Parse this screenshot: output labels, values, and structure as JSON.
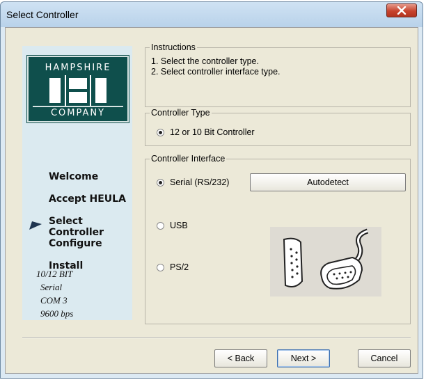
{
  "window": {
    "title": "Select Controller",
    "close_label": "x"
  },
  "logo": {
    "top": "HAMPSHIRE",
    "bottom": "COMPANY"
  },
  "steps": [
    "Welcome",
    "Accept HEULA",
    "Select Controller",
    "Configure",
    "Install"
  ],
  "current_step": "Select Controller",
  "status": {
    "line1": "10/12 BIT",
    "line2": "Serial",
    "line3": "COM 3",
    "line4": "9600 bps"
  },
  "instructions": {
    "label": "Instructions",
    "line1": "1. Select the controller type.",
    "line2": "2. Select controller interface type."
  },
  "controller_type": {
    "label": "Controller Type",
    "option": "12 or 10 Bit Controller",
    "selected": true
  },
  "controller_interface": {
    "label": "Controller Interface",
    "options": [
      "Serial (RS/232)",
      "USB",
      "PS/2"
    ],
    "selected": "Serial (RS/232)",
    "autodetect_label": "Autodetect"
  },
  "footer": {
    "back_label": "< Back",
    "next_label": "Next >",
    "cancel_label": "Cancel"
  },
  "colors": {
    "logo_bg": "#0f4f4c",
    "panel_bg": "#dbeaf0",
    "dialog_bg": "#ece9d8",
    "close_red": "#c7432d"
  }
}
